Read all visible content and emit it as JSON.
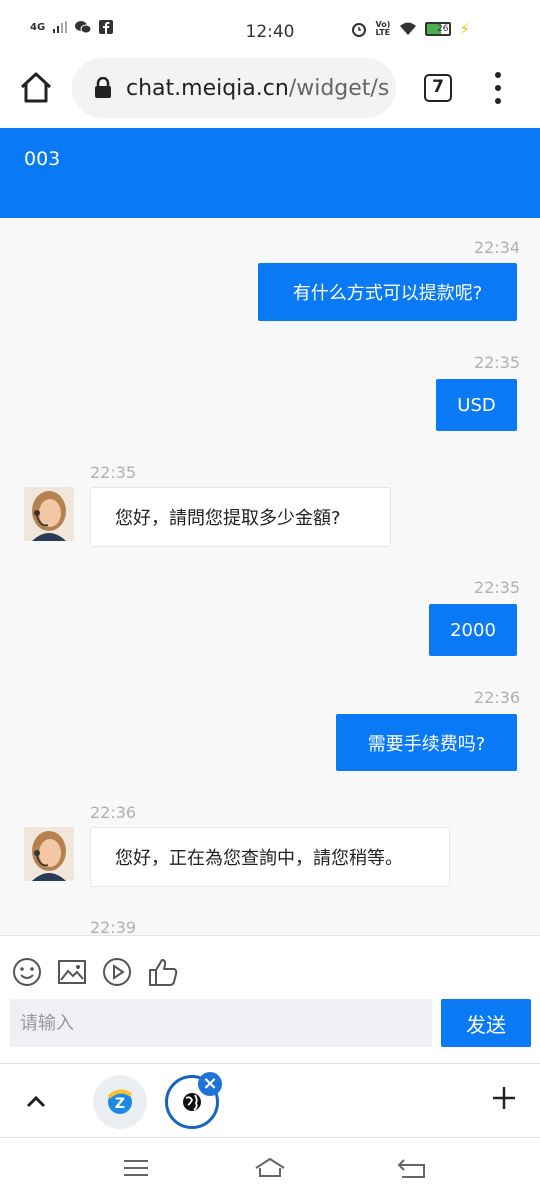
{
  "status_bar": {
    "time": "12:40",
    "network": "4G",
    "volte": "Vo) LTE",
    "battery": "26"
  },
  "browser": {
    "url_host": "chat.meiqia.cn",
    "url_path": "/widget/s",
    "tab_count": "7"
  },
  "chat": {
    "title": "003",
    "accent_color": "#0a79f5",
    "messages": [
      {
        "dir": "out",
        "time": "22:34",
        "text": "有什么方式可以提款呢?"
      },
      {
        "dir": "out",
        "time": "22:35",
        "text": "USD"
      },
      {
        "dir": "in",
        "time": "22:35",
        "text": "您好，請問您提取多少金額?"
      },
      {
        "dir": "out",
        "time": "22:35",
        "text": "2000"
      },
      {
        "dir": "out",
        "time": "22:36",
        "text": "需要手续费吗?"
      },
      {
        "dir": "in",
        "time": "22:36",
        "text": "您好，正在為您查詢中，請您稍等。"
      },
      {
        "dir": "in",
        "time": "22:39",
        "text": ""
      }
    ]
  },
  "composer": {
    "tools": [
      "emoji-icon",
      "image-icon",
      "video-icon",
      "thumbs-up-icon"
    ],
    "placeholder": "请输入",
    "send_label": "发送"
  },
  "tab_strip": {
    "close_glyph": "×"
  }
}
